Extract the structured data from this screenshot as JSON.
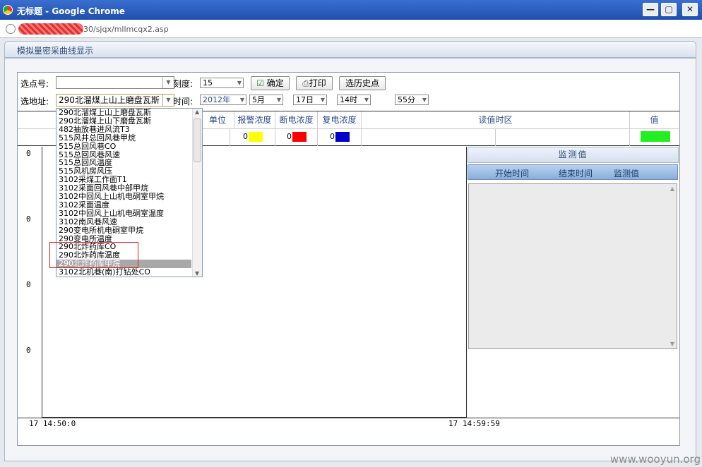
{
  "window": {
    "title": "无标题 - Google Chrome",
    "url": "30/sjqx/mllmcqx2.asp"
  },
  "app": {
    "header": "模拟量密采曲线显示"
  },
  "toolbar": {
    "point_no_label": "选点号:",
    "scale_label": "刻度:",
    "scale_value": "15",
    "confirm_label": "确定",
    "print_label": "打印",
    "history_label": "选历史点",
    "address_label": "选地址:",
    "address_value": "290北溜煤上山上磨盘瓦斯",
    "time_label": "时间:",
    "year": "2012年",
    "month": "5月",
    "day": "17日",
    "hour": "14时",
    "minute": "55分"
  },
  "grid": {
    "headers": [
      "单位",
      "报警浓度",
      "断电浓度",
      "复电浓度",
      "读值时区",
      "值"
    ],
    "row": {
      "alarm": "0",
      "cutoff": "0",
      "restore": "0"
    },
    "colors": {
      "alarm": "#ffff00",
      "cutoff": "#ff0000",
      "restore": "#0000cc",
      "value": "#22ee22"
    }
  },
  "chart_data": {
    "type": "line",
    "y_tick_labels": [
      "0",
      "0",
      "0",
      "0"
    ],
    "x_tick_labels": [
      "17 14:50:0",
      "17 14:59:59"
    ],
    "series": []
  },
  "monitor": {
    "title": "监测值",
    "columns": [
      "开始时间",
      "结束时间",
      "监测值"
    ]
  },
  "dropdown": {
    "items": [
      "290北溜煤上山上磨盘瓦斯",
      "290北溜煤上山下磨盘瓦斯",
      "482抽放巷进风流T3",
      "515风井总回风巷甲烷",
      "515总回风巷CO",
      "515总回风巷风速",
      "515总回风温度",
      "515风机房风压",
      "3102采煤工作面T1",
      "3102采面回风巷中部甲烷",
      "3102中回风上山机电硐室甲烷",
      "3102采面温度",
      "3102中回风上山机电硐室温度",
      "3102南风巷风速",
      "290变电所机电硐室甲烷",
      "290变电所温度",
      "290北炸药库CO",
      "290北炸药库温度",
      "290北炸药库甲烷",
      "3102北机巷(南)打钻处CO"
    ],
    "selected_index": 18
  },
  "watermark": "www.wooyun.org"
}
